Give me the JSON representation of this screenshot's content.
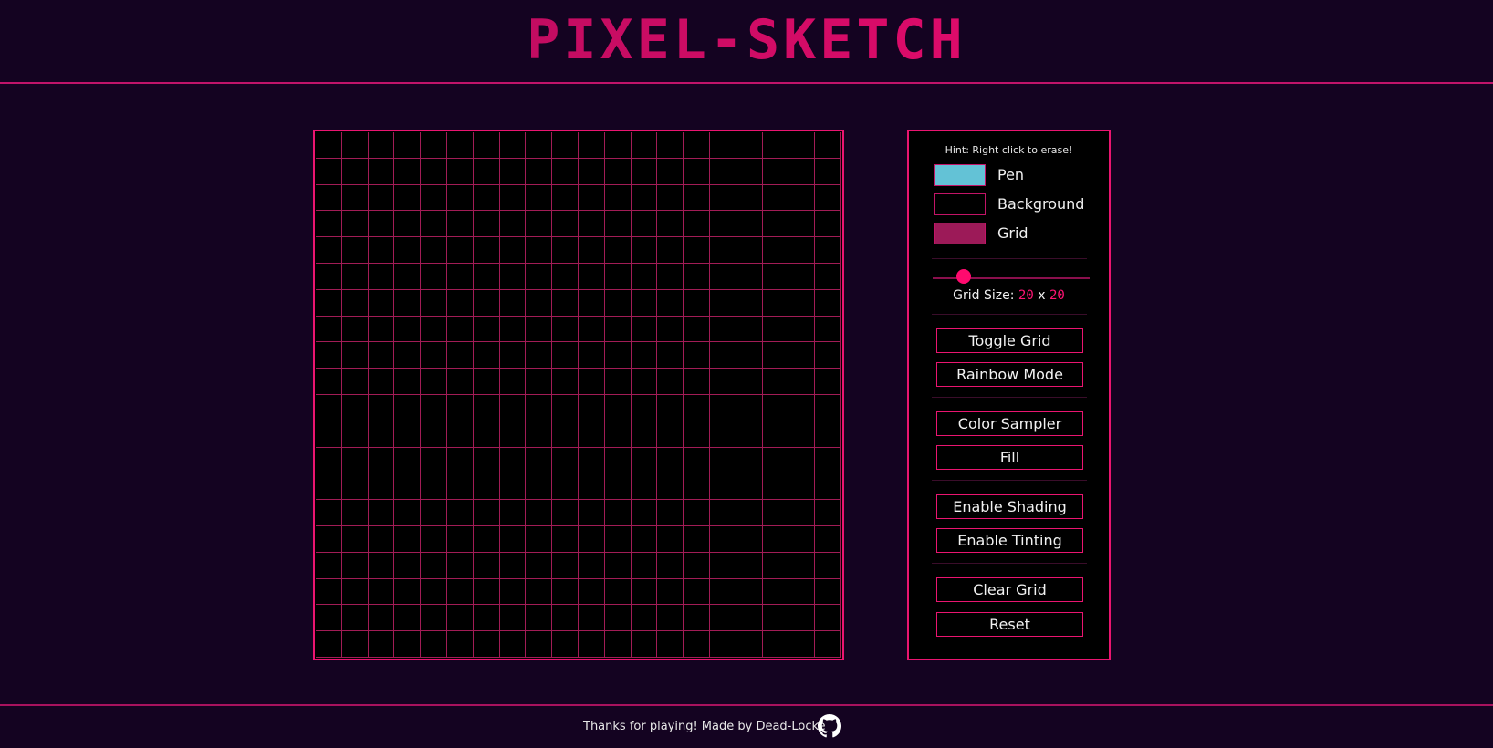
{
  "header": {
    "title": "PIXEL-SKETCH"
  },
  "grid": {
    "columns": 20,
    "rows": 20
  },
  "panel": {
    "hint": "Hint: Right click to erase!",
    "colors": [
      {
        "label": "Pen",
        "value": "#63c2d6"
      },
      {
        "label": "Background",
        "value": "#000000"
      },
      {
        "label": "Grid",
        "value": "#9c1a58"
      }
    ],
    "grid_size": {
      "label": "Grid Size:",
      "x": "20",
      "sep": "x",
      "y": "20",
      "slider_fraction": 0.2
    },
    "buttons": {
      "toggle_grid": "Toggle Grid",
      "rainbow_mode": "Rainbow Mode",
      "color_sampler": "Color Sampler",
      "fill": "Fill",
      "enable_shading": "Enable Shading",
      "enable_tinting": "Enable Tinting",
      "clear_grid": "Clear Grid",
      "reset": "Reset"
    }
  },
  "footer": {
    "text": "Thanks for playing! Made by Dead-Locke",
    "icon": "github-icon"
  },
  "theme": {
    "accent": "#ea1570",
    "background": "#140321"
  }
}
